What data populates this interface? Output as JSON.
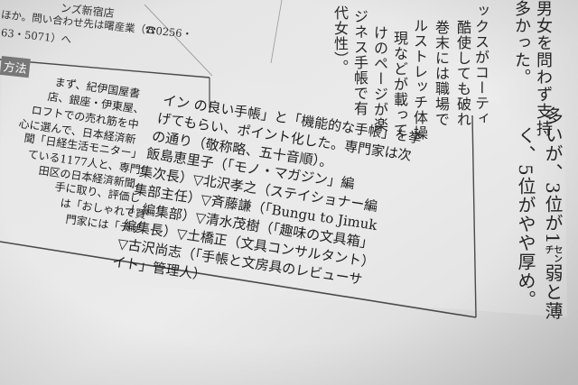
{
  "top_left_snippet": {
    "line1": "ンズ新宿店",
    "line2": "ほか。問い合わせ先は曙産業（☎0256・",
    "line3": "63・5071）へ"
  },
  "section_header": "方法",
  "left_column": [
    "まず、紀伊国屋書",
    "店、銀座・伊東屋、",
    "ロフトでの売れ筋を中",
    "心に選んで、日本経済新",
    "聞「日経生活モニター」",
    "ている1177人と、専門",
    "田区の日本経済新聞",
    "手に取り、評価し",
    "は「おしゃれで買",
    "門家には「デザ"
  ],
  "main_lines": [
    "イン の良い手帳」と「機能的な手帳」を挙",
    "げてもらい、ポイント化した。専門家は次",
    "の通り（敬称略、五十音順）。",
    "飯島恵里子（「モノ・マガジン」編",
    "集次長）▽北沢孝之（ステイショナー編",
    "集部主任）▽斉藤謙（「Bungu to Jimuk",
    "」編集部）▽清水茂樹（「趣味の文具箱」",
    "編集長）▽土橋正（文具コンサルタント）",
    "▽古沢尚志（「手帳と文房具のレビューサ",
    "イト」管理人）"
  ],
  "right_columns": [
    "男女を問わず支持",
    "多かった。",
    "ックスがコーティ",
    "酷使しても破れ",
    "巻末には職場で",
    "ルストレッチ体操",
    "現などが載って",
    "けのページが楽",
    "ジネス手帳で有",
    "代女性）。"
  ],
  "far_right": {
    "line1": "多いが、3位が1㌢弱と薄",
    "line2": "く、5位がやや厚め。"
  }
}
